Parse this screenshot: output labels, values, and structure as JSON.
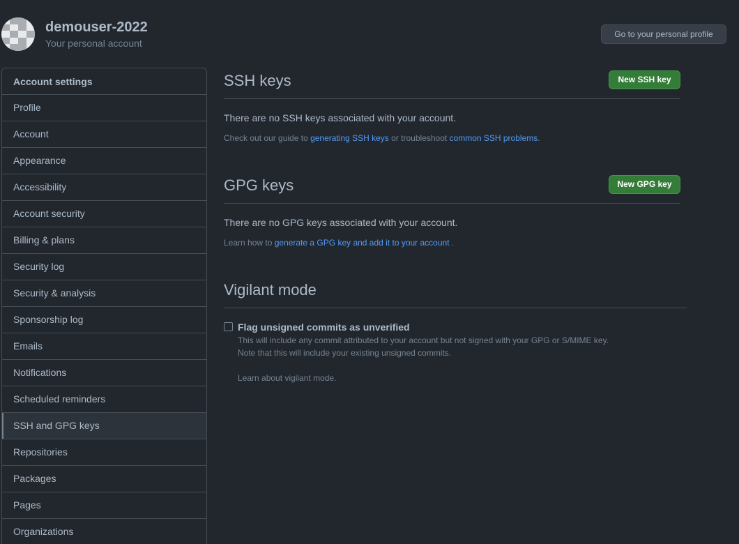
{
  "header": {
    "username": "demouser-2022",
    "subtitle": "Your personal account",
    "profile_button": "Go to your personal profile"
  },
  "sidebar": {
    "heading": "Account settings",
    "items": [
      {
        "label": "Profile"
      },
      {
        "label": "Account"
      },
      {
        "label": "Appearance"
      },
      {
        "label": "Accessibility"
      },
      {
        "label": "Account security"
      },
      {
        "label": "Billing & plans"
      },
      {
        "label": "Security log"
      },
      {
        "label": "Security & analysis"
      },
      {
        "label": "Sponsorship log"
      },
      {
        "label": "Emails"
      },
      {
        "label": "Notifications"
      },
      {
        "label": "Scheduled reminders"
      },
      {
        "label": "SSH and GPG keys"
      },
      {
        "label": "Repositories"
      },
      {
        "label": "Packages"
      },
      {
        "label": "Pages"
      },
      {
        "label": "Organizations"
      }
    ],
    "selected": "SSH and GPG keys"
  },
  "ssh": {
    "title": "SSH keys",
    "new_button": "New SSH key",
    "empty": "There are no SSH keys associated with your account.",
    "help_prefix": "Check out our guide to ",
    "help_link1": "generating SSH keys",
    "help_middle": " or troubleshoot ",
    "help_link2": "common SSH problems",
    "help_suffix": "."
  },
  "gpg": {
    "title": "GPG keys",
    "new_button": "New GPG key",
    "empty": "There are no GPG keys associated with your account.",
    "help_prefix": "Learn how to ",
    "help_link": "generate a GPG key and add it to your account",
    "help_suffix": " ."
  },
  "vigilant": {
    "title": "Vigilant mode",
    "checkbox_label": "Flag unsigned commits as unverified",
    "checked": false,
    "note1": "This will include any commit attributed to your account but not signed with your GPG or S/MIME key.",
    "note2": "Note that this will include your existing unsigned commits.",
    "learn_link": "Learn about vigilant mode."
  },
  "colors": {
    "background": "#22272e",
    "link": "#539bf5",
    "primary_button": "#347d39"
  }
}
